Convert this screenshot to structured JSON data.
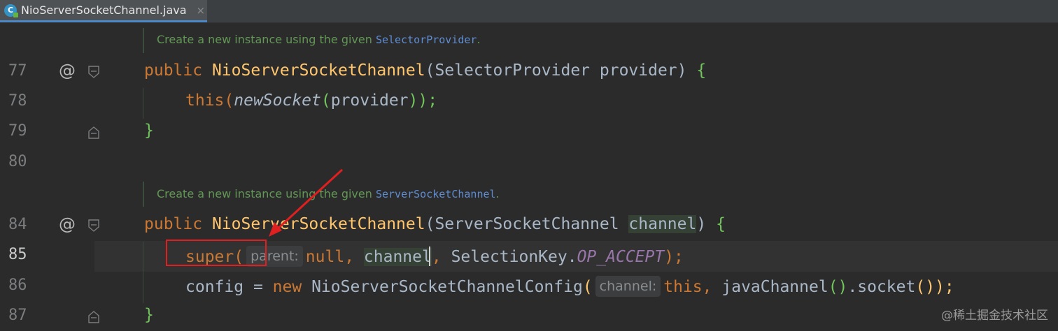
{
  "tab": {
    "filename": "NioServerSocketChannel.java",
    "close": "×",
    "icon_letter": "C"
  },
  "gutter": {
    "at_symbol": "@"
  },
  "lines": {
    "n77": "77",
    "n78": "78",
    "n79": "79",
    "n80": "80",
    "n84": "84",
    "n85": "85",
    "n86": "86",
    "n87": "87"
  },
  "doc1": {
    "text": "Create a new instance using the given ",
    "ref": "SelectorProvider",
    "end": "."
  },
  "doc2": {
    "text": "Create a new instance using the given ",
    "ref": "ServerSocketChannel",
    "end": "."
  },
  "l77": {
    "kw": "public",
    "name": "NioServerSocketChannel",
    "open": "(",
    "type": "SelectorProvider",
    "param": "provider",
    "close": ")",
    "brace": "{"
  },
  "l78": {
    "kw": "this",
    "open": "(",
    "method": "newSocket",
    "open2": "(",
    "arg": "provider",
    "close": "));"
  },
  "l79": {
    "brace": "}"
  },
  "l84": {
    "kw": "public",
    "name": "NioServerSocketChannel",
    "open": "(",
    "type": "ServerSocketChannel",
    "param": "channel",
    "close": ")",
    "brace": "{"
  },
  "l85": {
    "kw": "super",
    "open": "(",
    "hint": "parent:",
    "null": "null",
    "comma1": ",",
    "var": "channel",
    "comma2": ",",
    "cls": "SelectionKey.",
    "const": "OP_ACCEPT",
    "close": ");"
  },
  "l86": {
    "var": "config",
    "eq": "=",
    "kw_new": "new",
    "cls": "NioServerSocketChannelConfig",
    "open": "(",
    "hint": "channel:",
    "kw_this": "this",
    "comma": ",",
    "call": "javaChannel",
    "paren": "()",
    "dot": ".",
    "socket": "socket",
    "close": "());"
  },
  "l87": {
    "brace": "}"
  },
  "watermark": "@稀土掘金技术社区",
  "colors": {
    "background": "#2b2b2b",
    "keyword": "#cc7832",
    "method": "#ffc66d",
    "text": "#a9b7c6",
    "doc": "#629755",
    "constant": "#9876aa",
    "annotation_red": "#e02020"
  }
}
